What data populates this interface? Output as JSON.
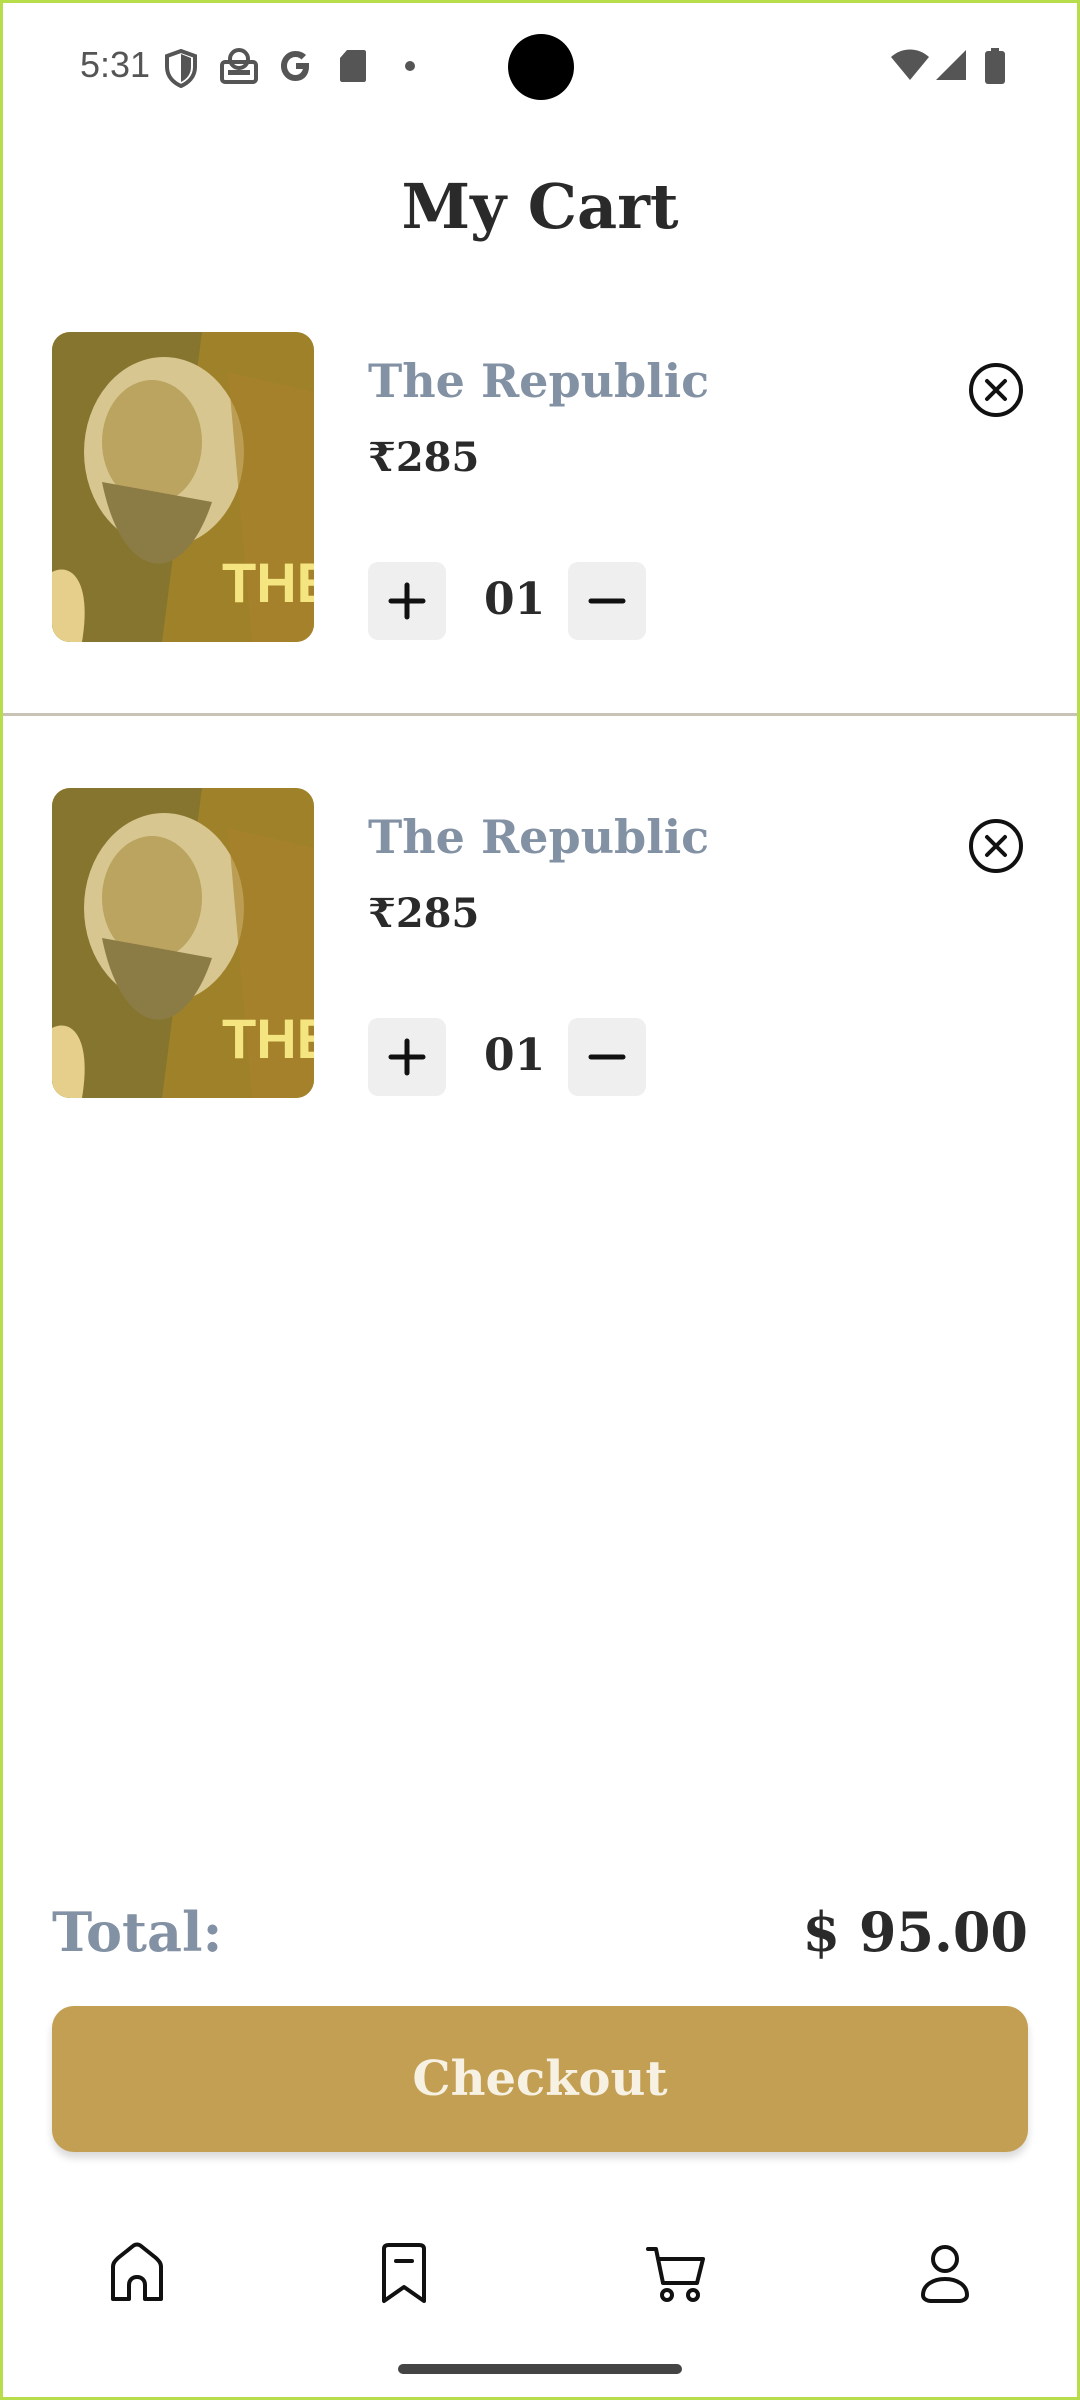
{
  "status_bar": {
    "time": "5:31"
  },
  "page": {
    "title": "My Cart"
  },
  "cart": {
    "items": [
      {
        "name": "The Republic",
        "price": "₹285",
        "quantity": "01",
        "cover_text": "THE REPU"
      },
      {
        "name": "The Republic",
        "price": "₹285",
        "quantity": "01",
        "cover_text": "THE REPU"
      }
    ]
  },
  "summary": {
    "total_label": "Total:",
    "total_value": "$ 95.00"
  },
  "actions": {
    "checkout_label": "Checkout"
  },
  "bottom_nav": [
    {
      "icon": "home-icon"
    },
    {
      "icon": "bookmark-icon"
    },
    {
      "icon": "cart-icon"
    },
    {
      "icon": "profile-icon"
    }
  ],
  "colors": {
    "accent": "#c29f52",
    "title_muted": "#8291a3",
    "text_dark": "#2a2a2a",
    "qty_bg": "#efefef"
  }
}
